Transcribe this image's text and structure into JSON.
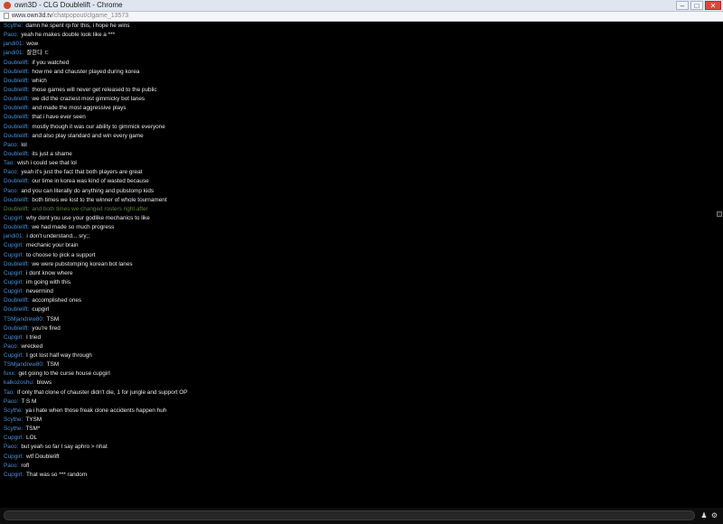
{
  "window": {
    "title": "own3D - CLG Doublelift - Chrome",
    "minimize": "–",
    "maximize": "□",
    "close": "✕"
  },
  "address": {
    "host": "www.own3d.tv",
    "path": "/chatpopout/clgame_13573"
  },
  "colors": {
    "username": "#4f8fd0",
    "message": "#e8e8e8",
    "faded": "#5d7f45",
    "background": "#000000"
  },
  "messages": [
    {
      "user": "Scythe:",
      "text": "damn he spent rp for this, i hope he wins"
    },
    {
      "user": "Paco:",
      "text": "yeah he makes double look like a ***"
    },
    {
      "user": "jandi01:",
      "text": "wow"
    },
    {
      "user": "jandi01:",
      "text": "잘한다 ㄷ"
    },
    {
      "user": "Doublelift:",
      "text": "if you watched"
    },
    {
      "user": "Doublelift:",
      "text": "how me and chauster played during korea"
    },
    {
      "user": "Doublelift:",
      "text": "which"
    },
    {
      "user": "Doublelift:",
      "text": "those games will never get released to the public"
    },
    {
      "user": "Doublelift:",
      "text": "we did the craziest most gimmicky bot lanes"
    },
    {
      "user": "Doublelift:",
      "text": "and made the most aggressive plays"
    },
    {
      "user": "Doublelift:",
      "text": "that i have ever seen"
    },
    {
      "user": "Doublelift:",
      "text": "mostly though it was our ability to gimmick everyone"
    },
    {
      "user": "Doublelift:",
      "text": "and also play standard and win every game"
    },
    {
      "user": "Paco:",
      "text": "lol"
    },
    {
      "user": "Doublelift:",
      "text": "its just a shame"
    },
    {
      "user": "Tao:",
      "text": "wish i could see that lol"
    },
    {
      "user": "Paco:",
      "text": "yeah it's just the fact that both players are great"
    },
    {
      "user": "Doublelift:",
      "text": "our time in korea was kind of wasted because"
    },
    {
      "user": "Paco:",
      "text": "and you can literally do anything and pubstomp kids"
    },
    {
      "user": "Doublelift:",
      "text": "both times we lost to the winner of whole tournament"
    },
    {
      "user": "Doublelift:",
      "text": "and both times we changed rosters right after",
      "faded": true
    },
    {
      "user": "Cupgirl:",
      "text": "why dont you use your godlike mechanics to like"
    },
    {
      "user": "Doublelift:",
      "text": "we had made so much progress"
    },
    {
      "user": "jandi01:",
      "text": "i don't understand... sry;;"
    },
    {
      "user": "Cupgirl:",
      "text": "mechanic your brain"
    },
    {
      "user": "Cupgirl:",
      "text": "to choose to pick a support"
    },
    {
      "user": "Doublelift:",
      "text": "we were pubstomping korean bot lanes"
    },
    {
      "user": "Cupgirl:",
      "text": "i dont know where"
    },
    {
      "user": "Cupgirl:",
      "text": "im going with this"
    },
    {
      "user": "Cupgirl:",
      "text": "nevermind"
    },
    {
      "user": "Doublelift:",
      "text": "accomplished ones"
    },
    {
      "user": "Doublelift:",
      "text": "cupgirl"
    },
    {
      "user": "TSMjandrew80:",
      "text": "TSM"
    },
    {
      "user": "Doublelift:",
      "text": "you're fired"
    },
    {
      "user": "Cupgirl:",
      "text": "I tried"
    },
    {
      "user": "Paco:",
      "text": "wrecked"
    },
    {
      "user": "Cupgirl:",
      "text": "I got lost half way through"
    },
    {
      "user": "TSMjandrew80:",
      "text": "TSM"
    },
    {
      "user": "fuxx:",
      "text": "get going to the curse house cupgirl"
    },
    {
      "user": "kalkozoshu:",
      "text": "blows"
    },
    {
      "user": "Tao:",
      "text": "if only that clone of chauster didn't die, 1 for jungle and support OP"
    },
    {
      "user": "Paco:",
      "text": "T S M"
    },
    {
      "user": "Scythe:",
      "text": "ya i hate when those freak clone accidents happen huh"
    },
    {
      "user": "Scythe:",
      "text": "TYSM"
    },
    {
      "user": "Scythe:",
      "text": "TSM*"
    },
    {
      "user": "Cupgirl:",
      "text": "LOL"
    },
    {
      "user": "Paco:",
      "text": "but yeah so far I say aphro > nhat"
    },
    {
      "user": "Cupgirl:",
      "text": "wtf Doublelift"
    },
    {
      "user": "Paco:",
      "text": "rofl"
    },
    {
      "user": "Cupgirl:",
      "text": "That was so *** random"
    }
  ],
  "input": {
    "value": "",
    "user_icon": "person-icon",
    "settings_icon": "gear-icon"
  }
}
